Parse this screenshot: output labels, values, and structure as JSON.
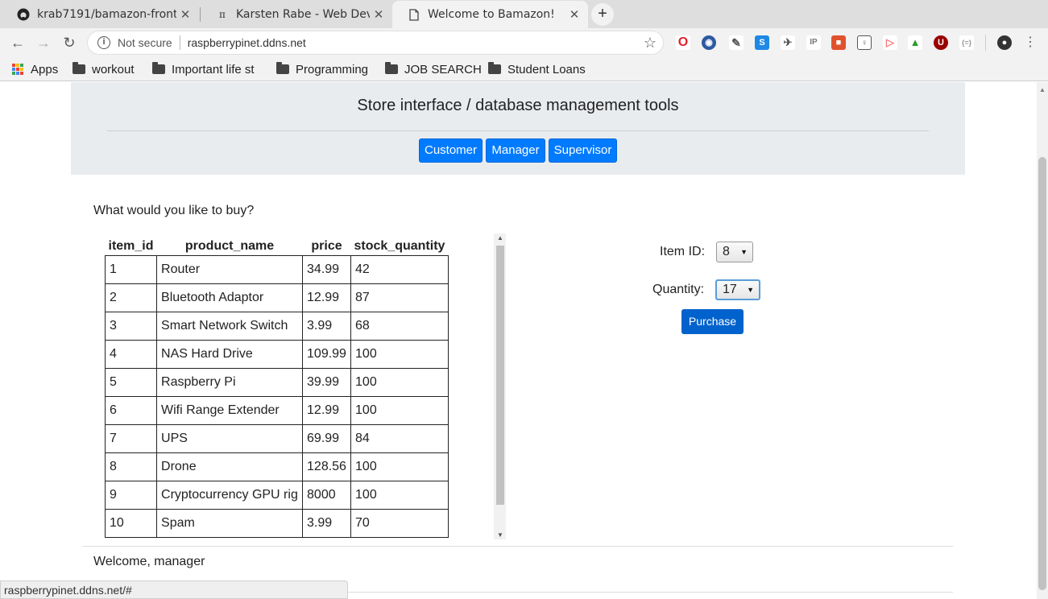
{
  "tabs": [
    {
      "title": "krab7191/bamazon-front",
      "icon": "github-icon",
      "active": false
    },
    {
      "title": "Karsten Rabe - Web Devel",
      "icon": "pi-icon",
      "active": false
    },
    {
      "title": "Welcome to Bamazon!",
      "icon": "page-icon",
      "active": true
    }
  ],
  "omnibox": {
    "security": "Not secure",
    "url": "raspberrypinet.ddns.net"
  },
  "bookmarks": [
    {
      "label": "Apps"
    },
    {
      "label": "workout"
    },
    {
      "label": "Important life st"
    },
    {
      "label": "Programming"
    },
    {
      "label": "JOB SEARCH"
    },
    {
      "label": "Student Loans"
    }
  ],
  "header": {
    "title": "Store interface / database management tools",
    "buttons": [
      "Customer",
      "Manager",
      "Supervisor"
    ],
    "accent": "#007bff"
  },
  "main": {
    "prompt": "What would you like to buy?",
    "columns": [
      "item_id",
      "product_name",
      "price",
      "stock_quantity"
    ],
    "rows": [
      [
        "1",
        "Router",
        "34.99",
        "42"
      ],
      [
        "2",
        "Bluetooth Adaptor",
        "12.99",
        "87"
      ],
      [
        "3",
        "Smart Network Switch",
        "3.99",
        "68"
      ],
      [
        "4",
        "NAS Hard Drive",
        "109.99",
        "100"
      ],
      [
        "5",
        "Raspberry Pi",
        "39.99",
        "100"
      ],
      [
        "6",
        "Wifi Range Extender",
        "12.99",
        "100"
      ],
      [
        "7",
        "UPS",
        "69.99",
        "84"
      ],
      [
        "8",
        "Drone",
        "128.56",
        "100"
      ],
      [
        "9",
        "Cryptocurrency GPU rig",
        "8000",
        "100"
      ],
      [
        "10",
        "Spam",
        "3.99",
        "70"
      ]
    ]
  },
  "form": {
    "item_label": "Item ID:",
    "item_value": "8",
    "quantity_label": "Quantity:",
    "quantity_value": "17",
    "purchase_label": "Purchase"
  },
  "footer": {
    "welcome": "Welcome, manager"
  },
  "status": {
    "url": "raspberrypinet.ddns.net/#"
  }
}
